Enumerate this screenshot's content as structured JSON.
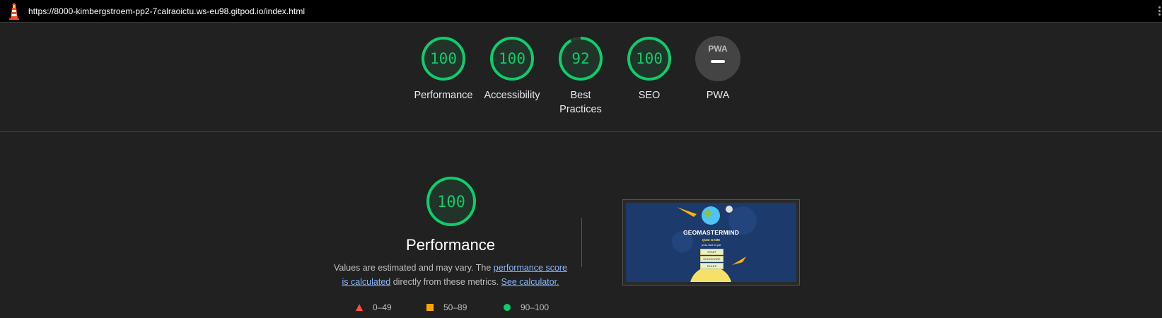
{
  "topbar": {
    "url": "https://8000-kimbergstroem-pp2-7calraoictu.ws-eu98.gitpod.io/index.html"
  },
  "summary": {
    "gauges": [
      {
        "label": "Performance",
        "score": "100",
        "value": 1.0
      },
      {
        "label": "Accessibility",
        "score": "100",
        "value": 1.0
      },
      {
        "label": "Best Practices",
        "score": "92",
        "value": 0.92
      },
      {
        "label": "SEO",
        "score": "100",
        "value": 1.0
      },
      {
        "label": "PWA",
        "badge": "PWA"
      }
    ]
  },
  "performance": {
    "score": "100",
    "title": "Performance",
    "desc_prefix": "Values are estimated and may vary. The ",
    "link_score": "performance score is calculated",
    "desc_middle": " directly from these metrics. ",
    "link_calc": "See calculator."
  },
  "legend": {
    "poor": "0–49",
    "average": "50–89",
    "good": "90–100"
  },
  "thumbnail": {
    "title": "GEOMASTERMIND",
    "subtitle": "QUIZ GAME",
    "hint": "press start to quiz",
    "buttons": [
      "START",
      "HIGHSCORE",
      "RULES"
    ]
  },
  "colors": {
    "good": "#0cce6b",
    "average": "#ffa400",
    "poor": "#ff4e42",
    "link": "#8ab4f8",
    "background": "#212121"
  }
}
